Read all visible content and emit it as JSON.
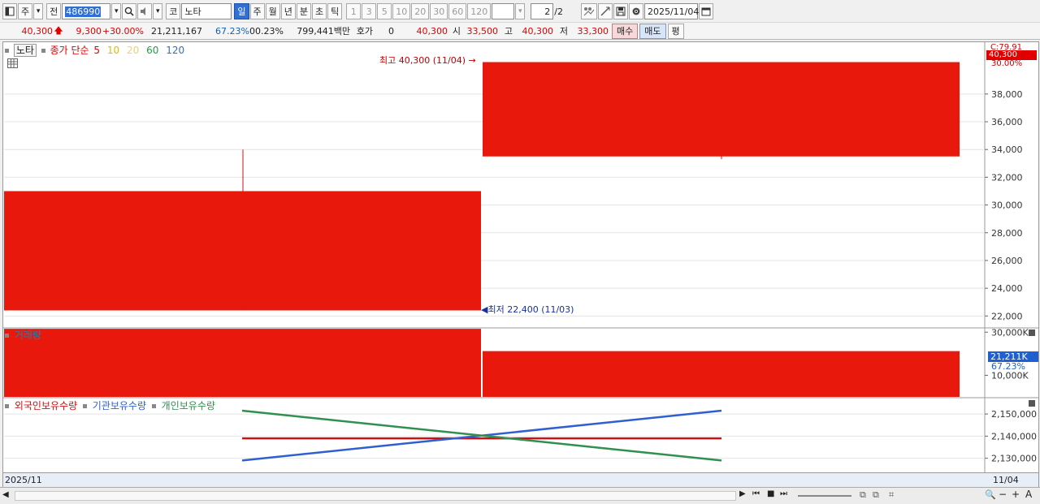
{
  "toolbar": {
    "market_label": "주",
    "prev_label": "전",
    "stock_code": "486990",
    "corp_badge": "코",
    "stock_name": "노타",
    "period_tabs": [
      "일",
      "주",
      "월",
      "년",
      "분",
      "초",
      "틱"
    ],
    "active_period": "일",
    "interval_buttons": [
      "1",
      "3",
      "5",
      "10",
      "20",
      "30",
      "60",
      "120"
    ],
    "page_current": "2",
    "page_total": "/2",
    "date": "2025/11/04"
  },
  "quote": {
    "price": "40,300",
    "change": "9,300",
    "change_pct": "+30.00%",
    "volume": "21,211,167",
    "volume_ratio": "67.23%",
    "turnover": "00.23%",
    "amount": "799,441백만",
    "hoga_label": "호가",
    "hoga_value": "0",
    "hoga_price": "40,300",
    "open_label": "시",
    "open": "33,500",
    "high_label": "고",
    "high": "40,300",
    "low_label": "저",
    "low": "33,300",
    "buy_label": "매수",
    "sell_label": "매도",
    "avg_label": "평"
  },
  "price_panel": {
    "name_badge": "노타",
    "legend_title": "종가 단순",
    "ma_periods": [
      {
        "label": "5",
        "color": "#e00000"
      },
      {
        "label": "10",
        "color": "#e8b800"
      },
      {
        "label": "20",
        "color": "#f0d070"
      },
      {
        "label": "60",
        "color": "#20a040"
      },
      {
        "label": "120",
        "color": "#3070c0"
      }
    ],
    "top_tag": "C:79.91",
    "price_tag": "40,300",
    "price_tag_pct": "30.00%",
    "high_annotation": "최고 40,300 (11/04)",
    "low_annotation": "최저 22,400 (11/03)"
  },
  "volume_panel": {
    "title": "거래량",
    "current_tag": "21,211K",
    "ratio_tag": "67.23%"
  },
  "holdings_panel": {
    "series_labels": [
      {
        "label": "외국인보유수량",
        "color": "#d01010"
      },
      {
        "label": "기관보유수량",
        "color": "#3060d0"
      },
      {
        "label": "개인보유수량",
        "color": "#309050"
      }
    ]
  },
  "footer": {
    "month_label": "2025/11",
    "last_date_label": "11/04"
  },
  "chart_data": {
    "type": "candlestick",
    "dates": [
      "11/03",
      "11/04"
    ],
    "price": {
      "ylim": [
        21200,
        41500
      ],
      "y_ticks": [
        22000,
        24000,
        26000,
        28000,
        30000,
        32000,
        34000,
        36000,
        38000
      ],
      "candles": [
        {
          "date": "11/03",
          "open": 22400,
          "high": 34000,
          "low": 22400,
          "close": 31000
        },
        {
          "date": "11/04",
          "open": 33500,
          "high": 40300,
          "low": 33300,
          "close": 40300
        }
      ]
    },
    "volume": {
      "unit": "K",
      "ylim": [
        0,
        31600
      ],
      "y_ticks": [
        10000,
        30000
      ],
      "values": [
        31550,
        21211
      ]
    },
    "holdings": {
      "ylim": [
        2124000,
        2157000
      ],
      "y_ticks": [
        2130000,
        2140000,
        2150000
      ],
      "series": [
        {
          "name": "외국인보유수량",
          "color": "#d01010",
          "values": [
            2139000,
            2139000
          ]
        },
        {
          "name": "기관보유수량",
          "color": "#3060d0",
          "values": [
            2129000,
            2151500
          ]
        },
        {
          "name": "개인보유수량",
          "color": "#309050",
          "values": [
            2151500,
            2129000
          ]
        }
      ]
    }
  }
}
